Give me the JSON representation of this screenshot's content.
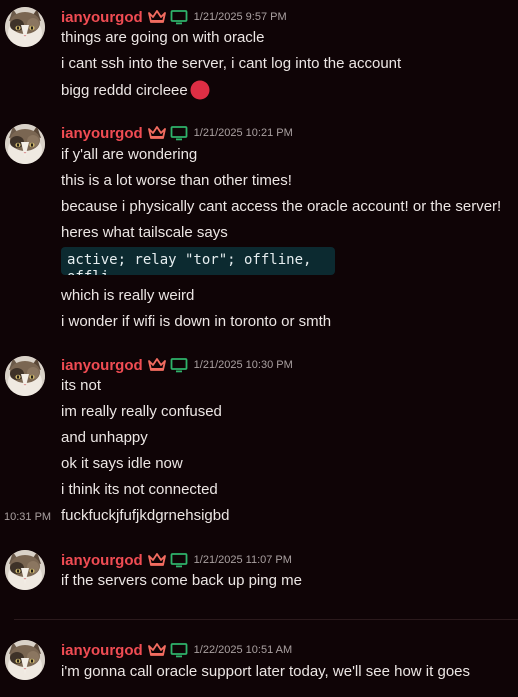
{
  "username": "ianyourgod",
  "colors": {
    "background": "#0f0406",
    "username": "#f04c53",
    "timestamp": "#a9a0a0",
    "text": "#ece6e4",
    "code_bg": "#0c2a30",
    "crown": "#f26c60",
    "monitor": "#2fb36b",
    "red_circle": "#dd2e44"
  },
  "icons": {
    "crown": "crown-icon",
    "monitor": "monitor-icon",
    "red_circle": "red-circle-emoji-icon"
  },
  "messages": [
    {
      "timestamp": "1/21/2025 9:57 PM",
      "lines": [
        "things are going on with oracle",
        "i cant ssh into the server, i cant log into the account",
        "bigg reddd circleee"
      ]
    },
    {
      "timestamp": "1/21/2025 10:21 PM",
      "lines": [
        "if y'all are wondering",
        "this is a lot worse than other times!",
        "because i physically cant access the oracle account! or the server!",
        "heres what tailscale says"
      ],
      "code_line": "active; relay \"tor\"; offline,",
      "code_overflow": "offli",
      "after_lines": [
        "which is really weird",
        "i wonder if wifi is down in toronto or smth"
      ]
    },
    {
      "timestamp": "1/21/2025 10:30 PM",
      "lines": [
        "its not",
        "im really really confused",
        "and unhappy",
        "ok it says idle now",
        "i think its not connected",
        "fuckfuckjfufjkdgrnehsigbd"
      ],
      "hover_time": "10:31 PM"
    },
    {
      "timestamp": "1/21/2025 11:07 PM",
      "lines": [
        "if the servers come back up ping me"
      ]
    },
    {
      "timestamp": "1/22/2025 10:51 AM",
      "lines": [
        "i'm gonna call oracle support later today, we'll see how it goes"
      ]
    }
  ]
}
